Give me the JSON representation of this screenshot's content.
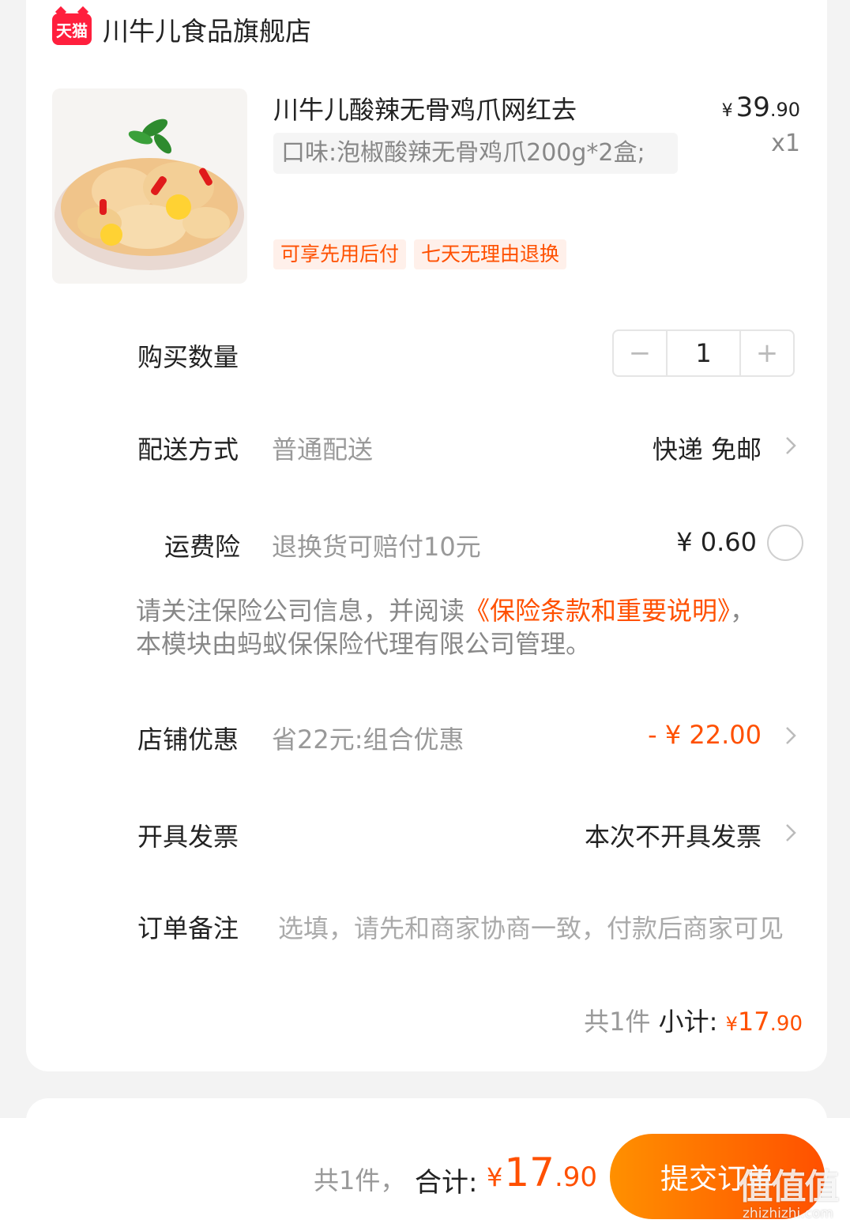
{
  "colors": {
    "accent": "#ff5000",
    "tmall_red": "#ff1f3d"
  },
  "shop": {
    "logo_text": "天猫",
    "name": "川牛儿食品旗舰店"
  },
  "product": {
    "title": "川牛儿酸辣无骨鸡爪网红去",
    "spec": "口味:泡椒酸辣无骨鸡爪200g*2盒;",
    "price_currency": "¥",
    "price_int": "39",
    "price_dec": ".90",
    "qty": "x1",
    "tags": [
      "可享先用后付",
      "七天无理由退换"
    ]
  },
  "quantity": {
    "label": "购买数量",
    "minus": "−",
    "value": "1",
    "plus": "+"
  },
  "delivery": {
    "label": "配送方式",
    "sub": "普通配送",
    "value": "快递 免邮"
  },
  "insurance": {
    "label": "运费险",
    "sub": "退换货可赔付10元",
    "value": "¥ 0.60"
  },
  "notice": {
    "pre": "请关注保险公司信息，并阅读",
    "link": "《保险条款和重要说明》",
    "post": "，本模块由蚂蚁保保险代理有限公司管理。"
  },
  "discount": {
    "label": "店铺优惠",
    "sub": "省22元:组合优惠",
    "value": "- ¥ 22.00"
  },
  "invoice": {
    "label": "开具发票",
    "value": "本次不开具发票"
  },
  "remark": {
    "label": "订单备注",
    "placeholder": "选填，请先和商家协商一致，付款后商家可见"
  },
  "subtotal": {
    "count": "共1件",
    "label": "小计:",
    "currency": "¥",
    "int": "17",
    "dec": ".90"
  },
  "bottom": {
    "count": "共1件，",
    "total_label": "合计:",
    "currency": "¥",
    "total_int": "17",
    "total_dec": ".90",
    "submit": "提交订单"
  },
  "watermark": {
    "main": "值值值",
    "sub": "zhizhizhi.com"
  }
}
